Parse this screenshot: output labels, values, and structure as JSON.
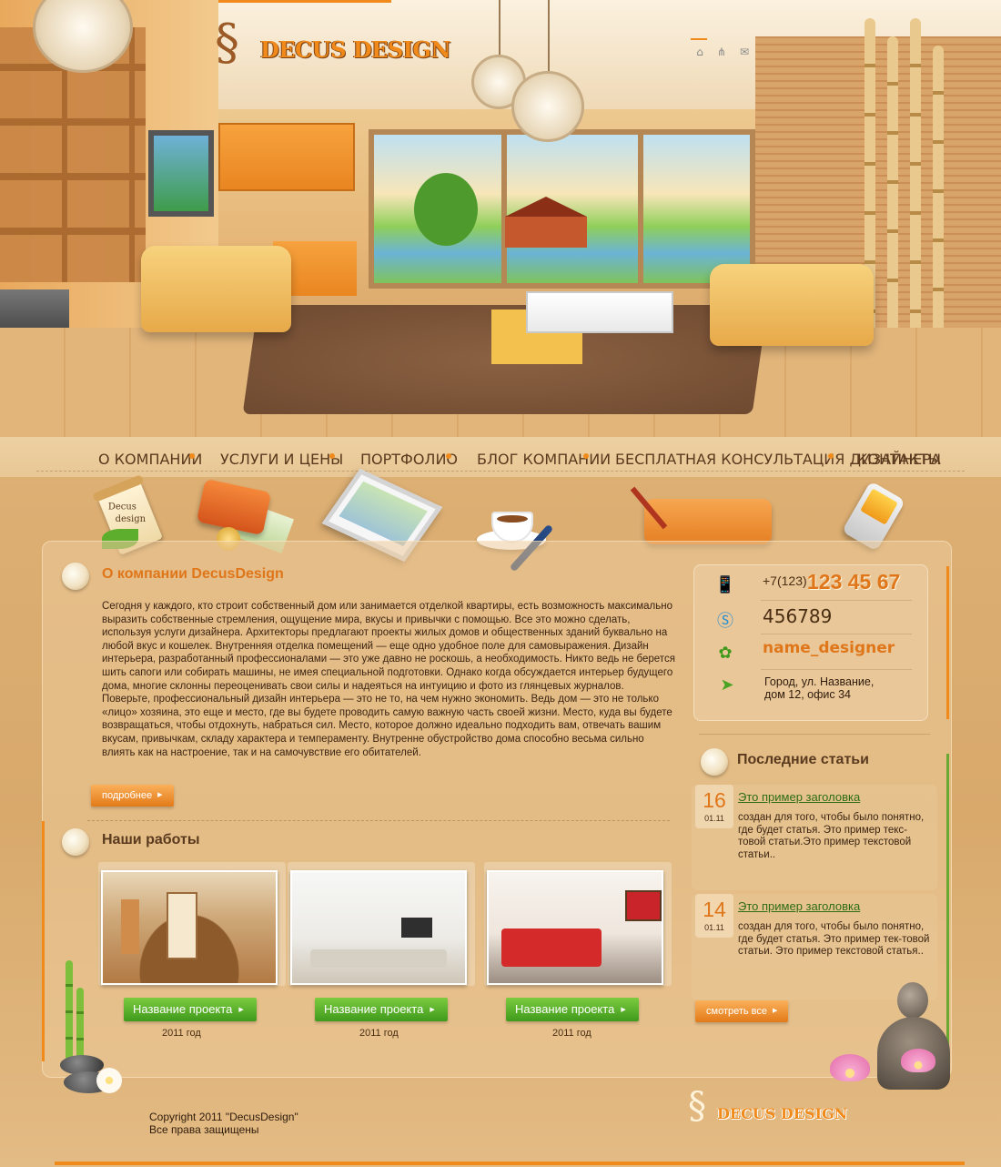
{
  "brand": {
    "logo_text": "DECUS DESIGN",
    "accent": "#f08a1a",
    "green": "#5aa828"
  },
  "top_icons": [
    "home-icon",
    "sitemap-icon",
    "mail-icon"
  ],
  "nav": {
    "items": [
      "О КОМПАНИИ",
      "УСЛУГИ И ЦЕНЫ",
      "ПОРТФОЛИО",
      "БЛОГ КОМПАНИИ",
      "БЕСПЛАТНАЯ КОНСУЛЬТАЦИЯ ДИЗАЙНЕРА",
      "КОНТАКТЫ"
    ]
  },
  "features": {
    "scroll_text_1": "Decus",
    "scroll_text_2": "design"
  },
  "about": {
    "title": "О компании DecusDesign",
    "text": "Сегодня у каждого, кто строит собственный дом или занимается отделкой квартиры, есть возможность максимально выразить собственные стремления, ощущение мира, вкусы и привычки с помощью. Все это можно сделать, используя услуги дизайнера. Архитекторы предлагают проекты жилых домов и общественных зданий буквально на любой вкус и кошелек. Внутренняя отделка помещений — еще одно удобное поле для самовыражения. Дизайн интерьера, разработанный профессионалами — это уже давно не роскошь, а необходимость. Никто ведь не берется шить сапоги или собирать машины, не имея специальной подготовки. Однако когда обсуждается интерьер будущего дома, многие склонны переоценивать свои силы и надеяться на интуицию и фото из глянцевых журналов. Поверьте, профессиональный дизайн интерьера — это не то, на чем нужно экономить. Ведь дом — это не только «лицо» хозяина, это еще и место, где вы будете проводить самую важную часть своей жизни. Место, куда вы будете возвращаться, чтобы отдохнуть, набраться сил. Место, которое должно идеально подходить вам, отвечать вашим вкусам, привычкам, складу характера и темпераменту. Внутренне обустройство дома способно весьма сильно влиять как на настроение, так и на самочувствие его обитателей.",
    "more_label": "подробнее"
  },
  "works": {
    "title": "Наши работы",
    "items": [
      {
        "name": "Название проекта",
        "year": "2011 год"
      },
      {
        "name": "Название проекта",
        "year": "2011 год"
      },
      {
        "name": "Название проекта",
        "year": "2011 год"
      }
    ]
  },
  "contacts": {
    "phone_code": "+7(123)",
    "phone_number": "123 45 67",
    "icq": "456789",
    "skype": "name_designer",
    "address_line1": "Город, ул. Название,",
    "address_line2": "дом 12, офис 34"
  },
  "articles": {
    "title": "Последние статьи",
    "items": [
      {
        "day": "16",
        "month": "01.11",
        "title": "Это пример заголовка",
        "text": "создан для того, чтобы было понятно, где будет статья. Это пример текс-товой статьи.Это пример текстовой статьи.."
      },
      {
        "day": "14",
        "month": "01.11",
        "title": "Это пример заголовка",
        "text": "создан для того, чтобы было понятно, где будет статья. Это пример тек-товой статьи. Это пример текстовой статья.."
      }
    ],
    "view_all_label": "смотреть все"
  },
  "footer": {
    "copyright": "Copyright 2011 \"DecusDesign\"\nВсе права защищены",
    "logo_text": "DECUS DESIGN"
  }
}
